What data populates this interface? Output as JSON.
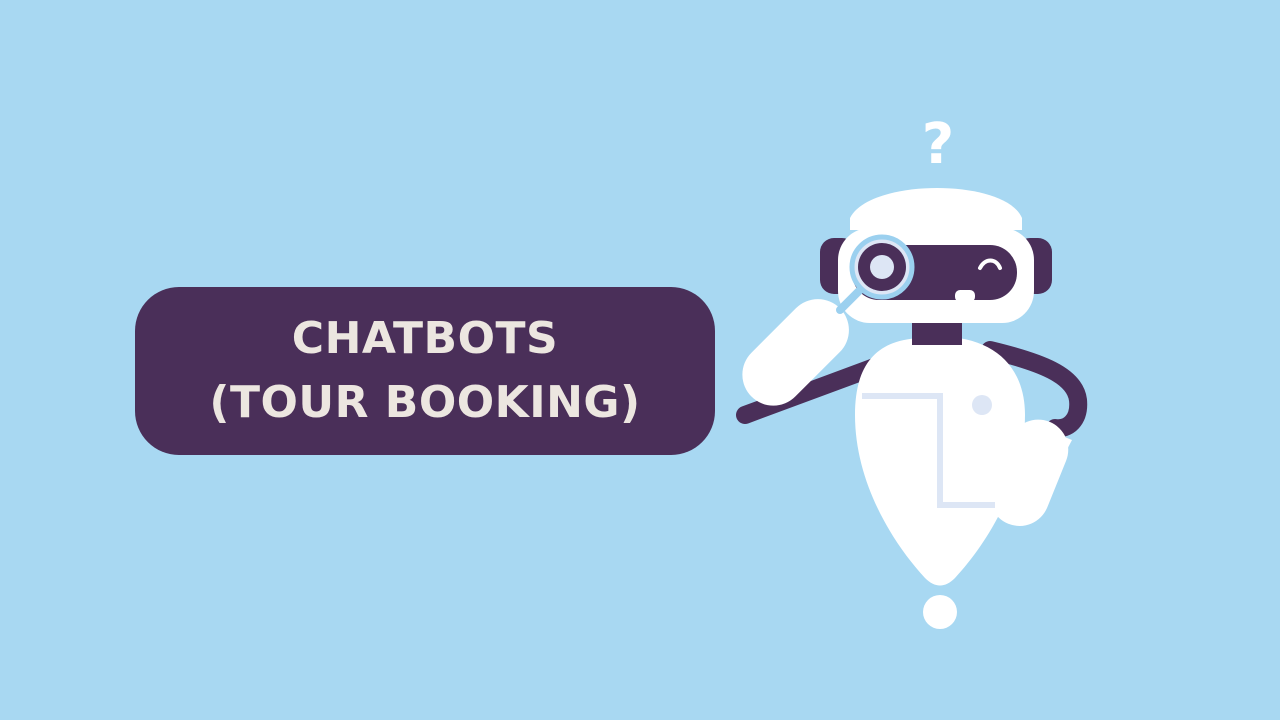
{
  "slide": {
    "title_line_1": "CHATBOTS",
    "title_line_2": "(TOUR BOOKING)",
    "question_mark": "?"
  },
  "colors": {
    "background": "#a8d8f2",
    "pill": "#4a2f59",
    "title_text": "#ece6e0",
    "robot_body": "#ffffff",
    "robot_dark": "#4a2f59",
    "robot_accent": "#dde6f5",
    "lens_ring": "#9bd0ef"
  },
  "illustration": {
    "subject": "robot-with-magnifying-glass"
  }
}
